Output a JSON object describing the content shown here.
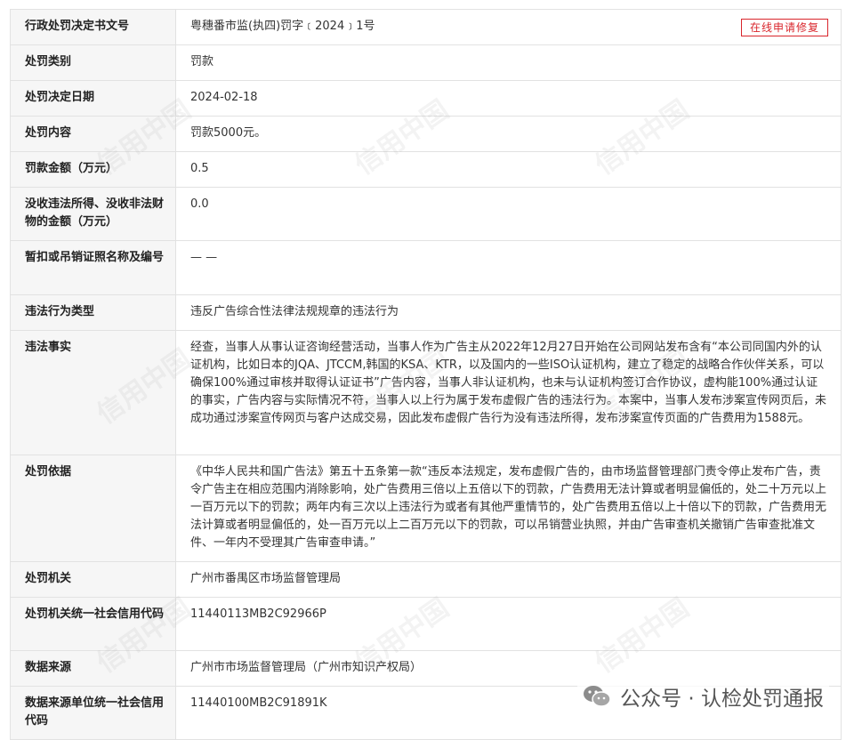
{
  "rows": [
    {
      "label": "行政处罚决定书文号",
      "value": "粤穗番市监(执四)罚字﹝2024﹞1号"
    },
    {
      "label": "处罚类别",
      "value": "罚款"
    },
    {
      "label": "处罚决定日期",
      "value": "2024-02-18"
    },
    {
      "label": "处罚内容",
      "value": "罚款5000元。"
    },
    {
      "label": "罚款金额（万元）",
      "value": "0.5"
    },
    {
      "label": "没收违法所得、没收非法财物的金额（万元）",
      "value": "0.0"
    },
    {
      "label": "暂扣或吊销证照名称及编号",
      "value": "— —"
    },
    {
      "label": "违法行为类型",
      "value": "违反广告综合性法律法规规章的违法行为"
    },
    {
      "label": "违法事实",
      "value": "经查，当事人从事认证咨询经营活动，当事人作为广告主从2022年12月27日开始在公司网站发布含有“本公司同国内外的认证机构，比如日本的JQA、JTCCM,韩国的KSA、KTR，以及国内的一些ISO认证机构，建立了稳定的战略合作伙伴关系，可以确保100%通过审核并取得认证证书”广告内容，当事人非认证机构，也未与认证机构签订合作协议，虚构能100%通过认证的事实，广告内容与实际情况不符，当事人以上行为属于发布虚假广告的违法行为。本案中，当事人发布涉案宣传网页后，未成功通过涉案宣传网页与客户达成交易，因此发布虚假广告行为没有违法所得，发布涉案宣传页面的广告费用为1588元。"
    },
    {
      "label": "处罚依据",
      "value": "《中华人民共和国广告法》第五十五条第一款“违反本法规定，发布虚假广告的，由市场监督管理部门责令停止发布广告，责令广告主在相应范围内消除影响，处广告费用三倍以上五倍以下的罚款，广告费用无法计算或者明显偏低的，处二十万元以上一百万元以下的罚款；两年内有三次以上违法行为或者有其他严重情节的，处广告费用五倍以上十倍以下的罚款，广告费用无法计算或者明显偏低的，处一百万元以上二百万元以下的罚款，可以吊销营业执照，并由广告审查机关撤销广告审查批准文件、一年内不受理其广告审查申请。”"
    },
    {
      "label": "处罚机关",
      "value": "广州市番禺区市场监督管理局"
    },
    {
      "label": "处罚机关统一社会信用代码",
      "value": "11440113MB2C92966P"
    },
    {
      "label": "数据来源",
      "value": "广州市市场监督管理局（广州市知识产权局）"
    },
    {
      "label": "数据来源单位统一社会信用代码",
      "value": "11440100MB2C91891K"
    }
  ],
  "repair_button": "在线申请修复",
  "watermark": "信用中国",
  "footer_badge": {
    "icon": "wechat-icon",
    "text": "公众号 · 认检处罚通报"
  },
  "colors": {
    "accent": "#d9262c"
  }
}
